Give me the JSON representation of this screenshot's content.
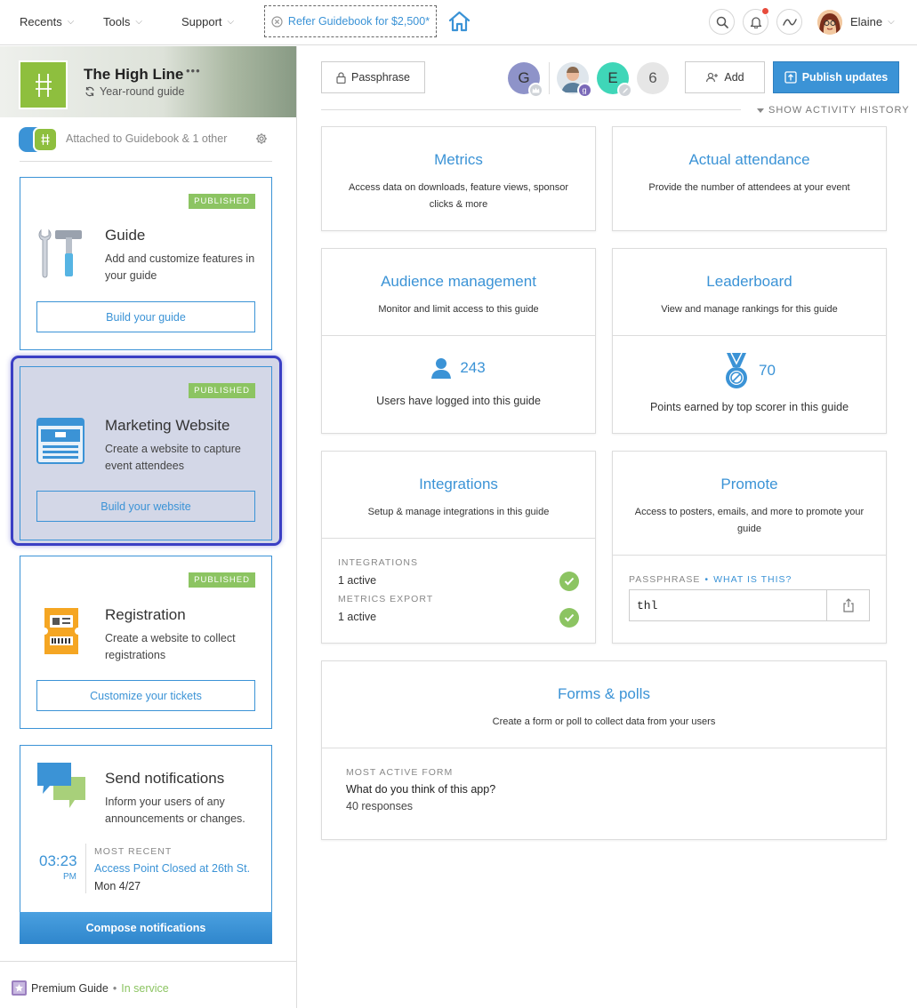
{
  "topbar": {
    "recents": "Recents",
    "tools": "Tools",
    "support": "Support",
    "refer": "Refer Guidebook for $2,500*",
    "user_name": "Elaine"
  },
  "guide": {
    "name": "The High Line",
    "more": "•••",
    "subtitle": "Year-round guide",
    "attached": "Attached to Guidebook & 1 other"
  },
  "cards": {
    "guide": {
      "badge": "PUBLISHED",
      "title": "Guide",
      "desc": "Add and customize features in your guide",
      "button": "Build your guide"
    },
    "website": {
      "badge": "PUBLISHED",
      "title": "Marketing Website",
      "desc": "Create a website to capture event attendees",
      "button": "Build your website"
    },
    "registration": {
      "badge": "PUBLISHED",
      "title": "Registration",
      "desc": "Create a website to collect registrations",
      "button": "Customize your tickets"
    },
    "notifications": {
      "title": "Send notifications",
      "desc": "Inform your users of any announcements or changes.",
      "time": "03:23",
      "ampm": "PM",
      "recent_label": "MOST RECENT",
      "recent_title": "Access Point Closed at 26th St.",
      "recent_date": "Mon 4/27",
      "button": "Compose notifications"
    }
  },
  "sidebar_footer": {
    "plan": "Premium Guide",
    "sep": "•",
    "status": "In service"
  },
  "toolbar": {
    "passphrase": "Passphrase",
    "avatar_g": "G",
    "avatar_e": "E",
    "more_count": "6",
    "add": "Add",
    "publish": "Publish updates",
    "activity": "SHOW ACTIVITY HISTORY"
  },
  "panels": {
    "metrics": {
      "title": "Metrics",
      "desc": "Access data on downloads, feature views, sponsor clicks & more"
    },
    "attendance": {
      "title": "Actual attendance",
      "desc": "Provide the number of attendees at your event"
    },
    "audience": {
      "title": "Audience management",
      "desc": "Monitor and limit access to this guide",
      "count": "243",
      "stat": "Users have logged into this guide"
    },
    "leaderboard": {
      "title": "Leaderboard",
      "desc": "View and manage rankings for this guide",
      "count": "70",
      "stat": "Points earned by top scorer in this guide"
    },
    "integrations": {
      "title": "Integrations",
      "desc": "Setup & manage integrations in this guide",
      "label1": "INTEGRATIONS",
      "value1": "1 active",
      "label2": "METRICS EXPORT",
      "value2": "1 active"
    },
    "promote": {
      "title": "Promote",
      "desc": "Access to posters, emails, and more to promote your guide",
      "pass_label": "PASSPHRASE",
      "sep": "•",
      "what": "WHAT IS THIS?",
      "pass_value": "thl"
    },
    "forms": {
      "title": "Forms & polls",
      "desc": "Create a form or poll to collect data from your users",
      "label": "MOST ACTIVE FORM",
      "question": "What do you think of this app?",
      "responses": "40 responses"
    }
  },
  "colors": {
    "accent": "#3b93d6",
    "green": "#8cc462",
    "selected_bg": "#d3d7e7",
    "selected_border": "#3b3fc4"
  }
}
